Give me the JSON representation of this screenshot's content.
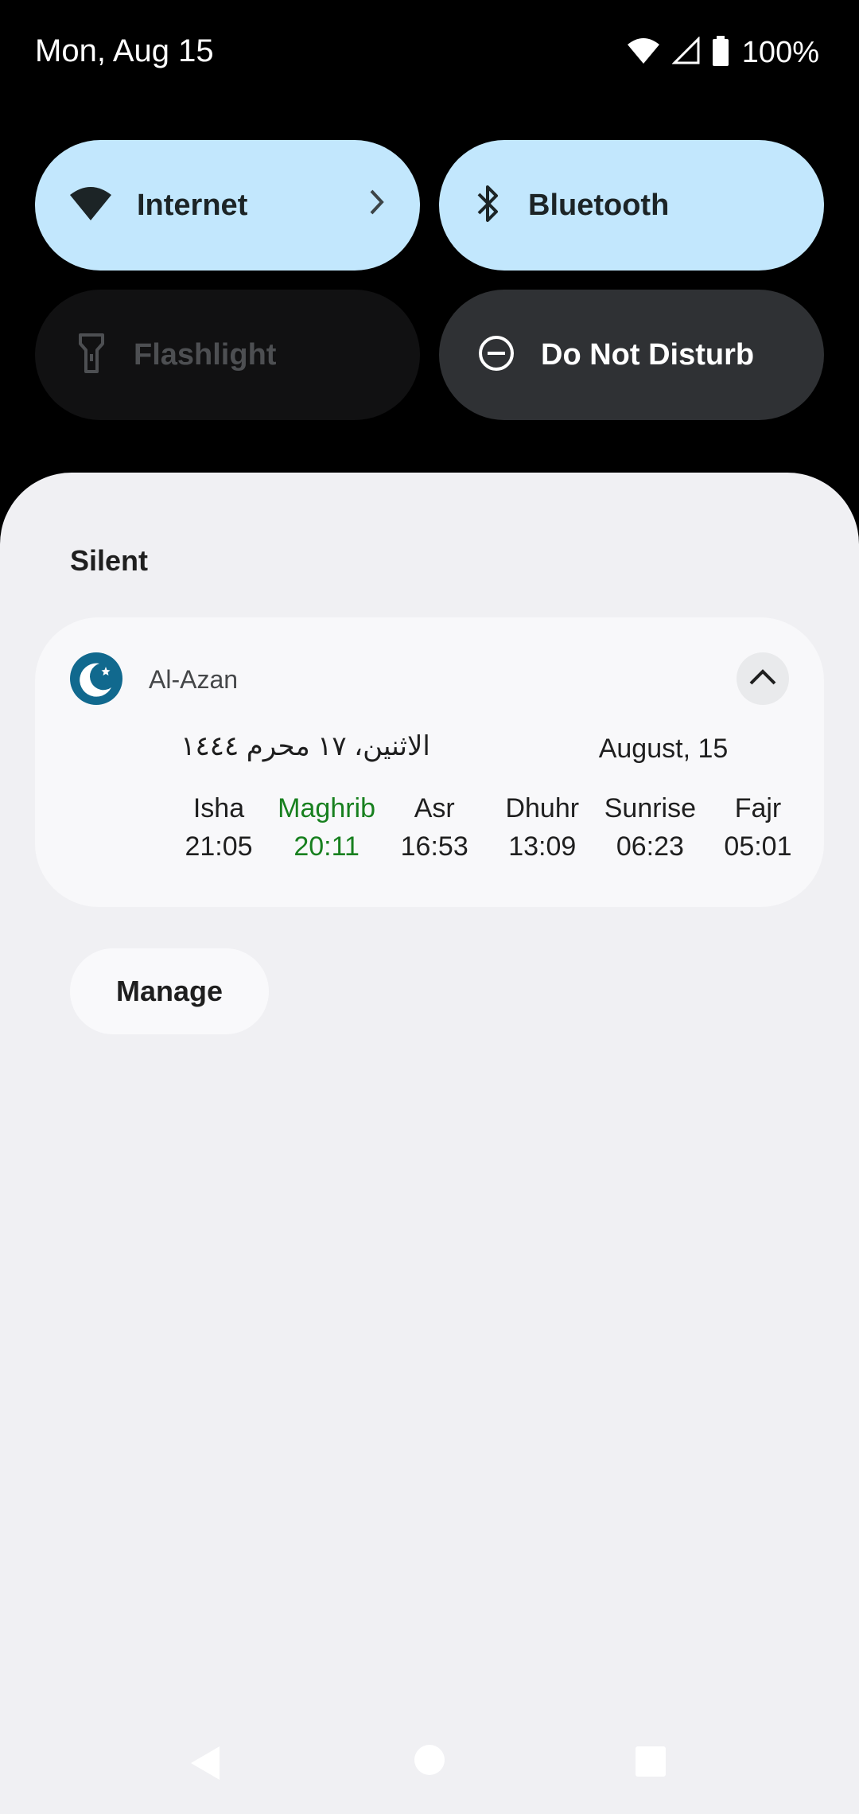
{
  "status_bar": {
    "date": "Mon, Aug 15",
    "battery": "100%"
  },
  "quick_settings": {
    "tiles": [
      {
        "label": "Internet",
        "state": "on"
      },
      {
        "label": "Bluetooth",
        "state": "on"
      },
      {
        "label": "Flashlight",
        "state": "off"
      },
      {
        "label": "Do Not Disturb",
        "state": "off"
      }
    ]
  },
  "notifications": {
    "section_title": "Silent",
    "card": {
      "app_name": "Al-Azan",
      "hijri_date": "الاثنين، ١٧ محرم ١٤٤٤",
      "gregorian_date": "August, 15",
      "prayers": [
        {
          "name": "Isha",
          "time": "21:05"
        },
        {
          "name": "Maghrib",
          "time": "20:11"
        },
        {
          "name": "Asr",
          "time": "16:53"
        },
        {
          "name": "Dhuhr",
          "time": "13:09"
        },
        {
          "name": "Sunrise",
          "time": "06:23"
        },
        {
          "name": "Fajr",
          "time": "05:01"
        }
      ],
      "active_prayer": "Maghrib"
    },
    "manage_label": "Manage"
  },
  "colors": {
    "tile_on": "#c2e7fd",
    "active_prayer": "#18801f",
    "app_icon": "#11698e"
  }
}
